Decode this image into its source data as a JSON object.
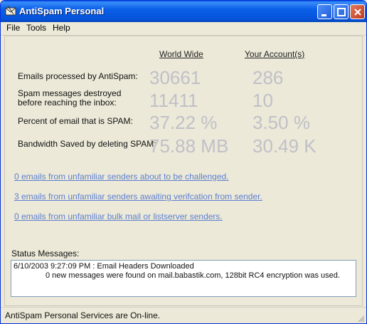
{
  "window": {
    "title": "AntiSpam Personal"
  },
  "menu": {
    "file": "File",
    "tools": "Tools",
    "help": "Help"
  },
  "columns": {
    "world_wide": "World Wide",
    "your_accounts": "Your Account(s)"
  },
  "stats": [
    {
      "label_lines": [
        "Emails processed by AntiSpam:"
      ],
      "world": "30661",
      "account": "286"
    },
    {
      "label_lines": [
        "Spam messages destroyed",
        "before reaching the inbox:"
      ],
      "world": "11411",
      "account": "10"
    },
    {
      "label_lines": [
        "Percent of email that is SPAM:"
      ],
      "world": "37.22 %",
      "account": "3.50 %"
    },
    {
      "label_lines": [
        "Bandwidth Saved by deleting SPAM:"
      ],
      "world": "75.88 MB",
      "account": "30.49 K"
    }
  ],
  "links": [
    "0 emails from unfamiliar senders about to be challenged.",
    "3 emails from unfamiliar senders awaiting verifcation from sender.",
    "0 emails from unfamiliar bulk mail or listserver senders."
  ],
  "status": {
    "label": "Status Messages:",
    "line1": "6/10/2003 9:27:09 PM : Email Headers Downloaded",
    "line2": "0 new messages were found on mail.babastik.com, 128bit RC4 encryption was used."
  },
  "statusbar": {
    "text": "AntiSpam Personal Services are On-line."
  },
  "colors": {
    "title_gradient": "#0A5FE8",
    "link": "#5C7FD0",
    "big_value": "#C0C0C8",
    "close_button": "#C0391E"
  },
  "icons": {
    "app": "envelope-icon",
    "minimize": "minimize-icon",
    "maximize": "maximize-icon",
    "close": "close-icon"
  }
}
